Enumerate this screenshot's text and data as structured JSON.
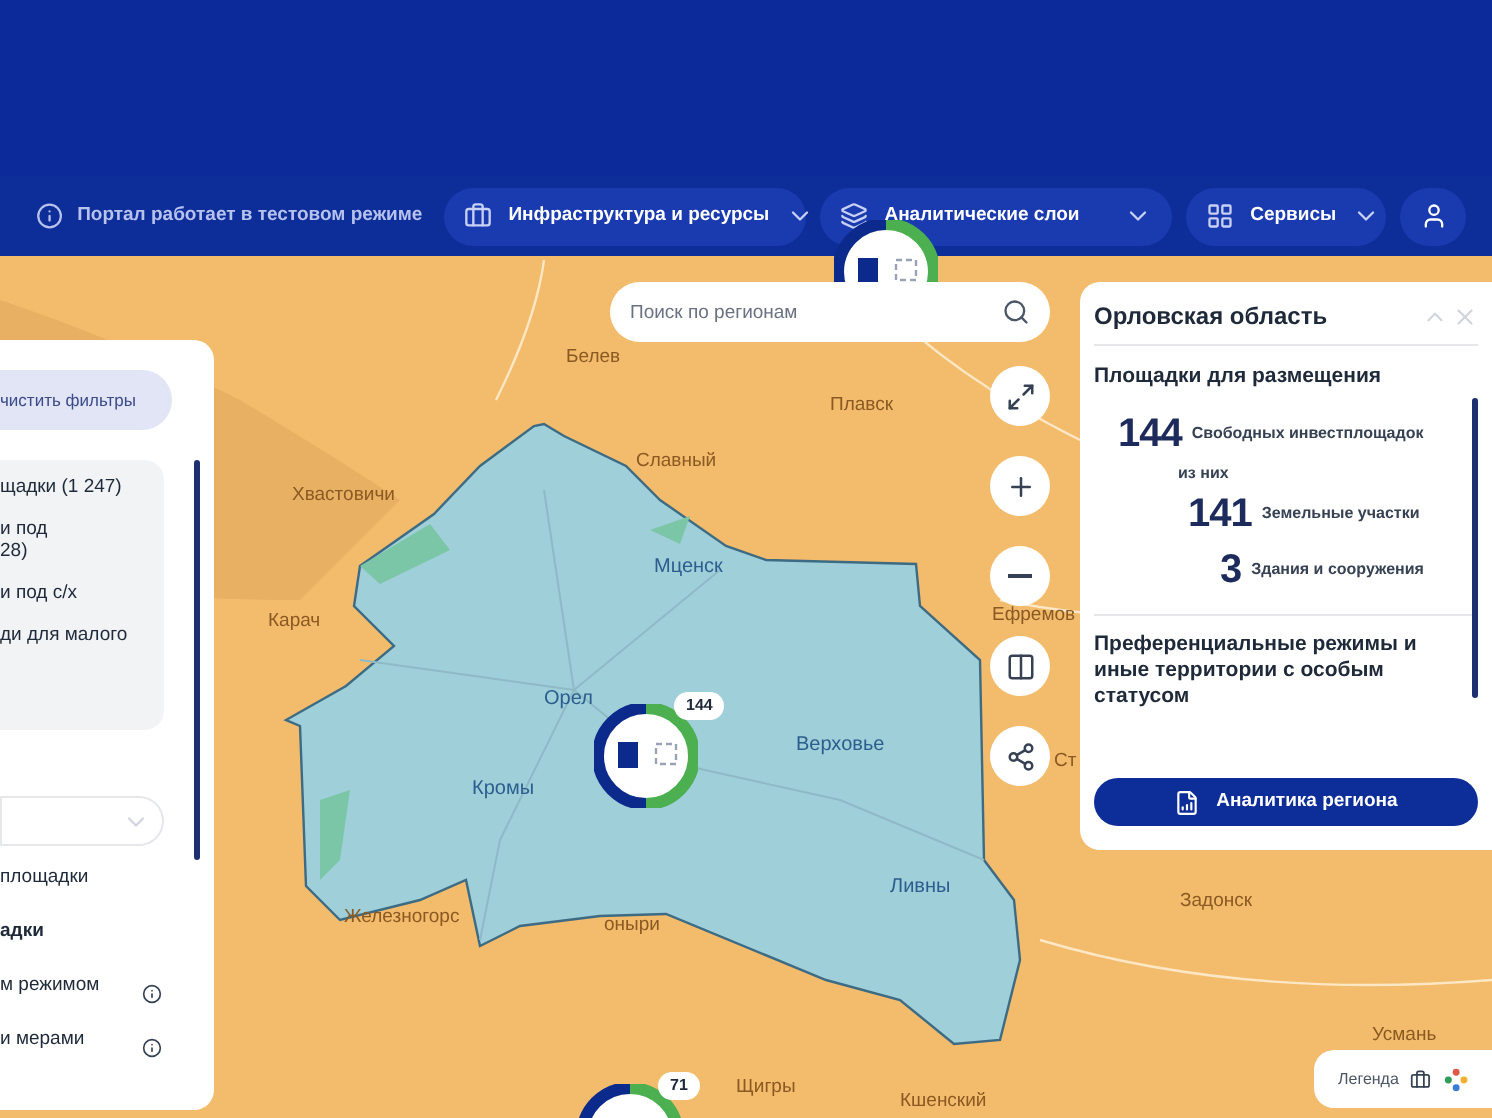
{
  "nav": {
    "notice": "Портал работает в тестовом режиме",
    "menus": [
      {
        "kind": "briefcase",
        "label": "Инфраструктура и ресурсы"
      },
      {
        "kind": "layers",
        "label": "Аналитические слои"
      },
      {
        "kind": "grid",
        "label": "Сервисы"
      }
    ]
  },
  "search": {
    "placeholder": "Поиск по регионам"
  },
  "filters": {
    "clear_button": "чистить фильтры",
    "options": [
      {
        "lines": [
          "щадки (1 247)"
        ]
      },
      {
        "lines": [
          "и под",
          "28)"
        ]
      },
      {
        "lines": [
          "и под с/х"
        ]
      },
      {
        "lines": [
          "ди для малого"
        ]
      }
    ],
    "list": [
      {
        "label": "площадки",
        "bold": false,
        "info": false
      },
      {
        "label": "адки",
        "bold": true,
        "info": false
      },
      {
        "label": "м режимом",
        "bold": false,
        "info": true
      },
      {
        "label": "и мерами",
        "bold": false,
        "info": true
      }
    ]
  },
  "map": {
    "places": [
      {
        "label": "Белев",
        "kind": "outside"
      },
      {
        "label": "Плавск",
        "kind": "outside"
      },
      {
        "label": "Славный",
        "kind": "outside"
      },
      {
        "label": "Хвастовичи",
        "kind": "outside"
      },
      {
        "label": "Мценск",
        "kind": "inside"
      },
      {
        "label": "Карач",
        "kind": "outside"
      },
      {
        "label": "Ефремов",
        "kind": "outside"
      },
      {
        "label": "Орел",
        "kind": "inside"
      },
      {
        "label": "Верховье",
        "kind": "inside"
      },
      {
        "label": "Кромы",
        "kind": "inside"
      },
      {
        "label": "Ливны",
        "kind": "inside"
      },
      {
        "label": "Железногорс",
        "kind": "outside"
      },
      {
        "label": "оныри",
        "kind": "outside"
      },
      {
        "label": "Щигры",
        "kind": "outside"
      },
      {
        "label": "Кшенский",
        "kind": "outside"
      },
      {
        "label": "Задонск",
        "kind": "outside"
      },
      {
        "label": "Усмань",
        "kind": "outside"
      },
      {
        "label": "Ст",
        "kind": "outside"
      }
    ],
    "clusters": [
      {
        "kind": "donut"
      },
      {
        "kind": "donut",
        "count": "144"
      },
      {
        "kind": "donut",
        "count": "71"
      }
    ],
    "controls": [
      {
        "kind": "expand"
      },
      {
        "kind": "plus"
      },
      {
        "kind": "minus"
      },
      {
        "kind": "columns"
      },
      {
        "kind": "share"
      }
    ],
    "legend": "Легенда"
  },
  "region_panel": {
    "title": "Орловская область",
    "section": "Площадки для размещения",
    "stats": [
      {
        "value": "144",
        "label": "Свободных инвестплощадок",
        "note": "из них"
      },
      {
        "value": "141",
        "label": "Земельные участки"
      },
      {
        "value": "3",
        "label": "Здания и сооружения"
      }
    ],
    "section_2": "Преференциальные режимы и иные территории с особым статусом",
    "button": "Аналитика региона"
  }
}
